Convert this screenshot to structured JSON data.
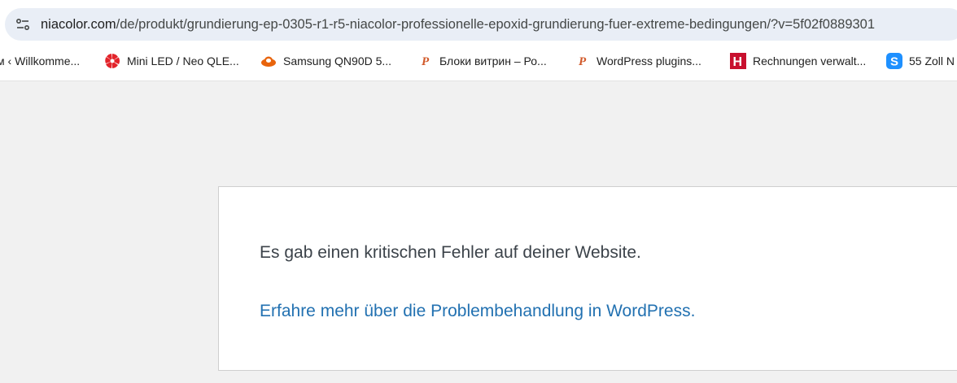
{
  "address_bar": {
    "host": "niacolor.com",
    "path": "/de/produkt/grundierung-ep-0305-r1-r5-niacolor-professionelle-epoxid-grundierung-fuer-extreme-bedingungen/?v=5f02f0889301"
  },
  "bookmarks": [
    {
      "label": "м ‹ Willkomme...",
      "icon": "none"
    },
    {
      "label": "Mini LED / Neo QLE...",
      "icon": "red-swirl-icon"
    },
    {
      "label": "Samsung QN90D 5...",
      "icon": "orange-hat-icon"
    },
    {
      "label": "Блоки витрин – Ро...",
      "icon": "pressable-icon"
    },
    {
      "label": "WordPress plugins...",
      "icon": "pressable-icon"
    },
    {
      "label": "Rechnungen verwalt...",
      "icon": "red-h-icon"
    },
    {
      "label": "55 Zoll N",
      "icon": "blue-s-icon"
    }
  ],
  "main": {
    "error_message": "Es gab einen kritischen Fehler auf deiner Website.",
    "help_link": "Erfahre mehr über die Problembehandlung in WordPress."
  },
  "colors": {
    "link": "#2271b1",
    "text": "#3c434a",
    "page_background": "#f1f1f1",
    "omnibox": "#e9eef6"
  }
}
